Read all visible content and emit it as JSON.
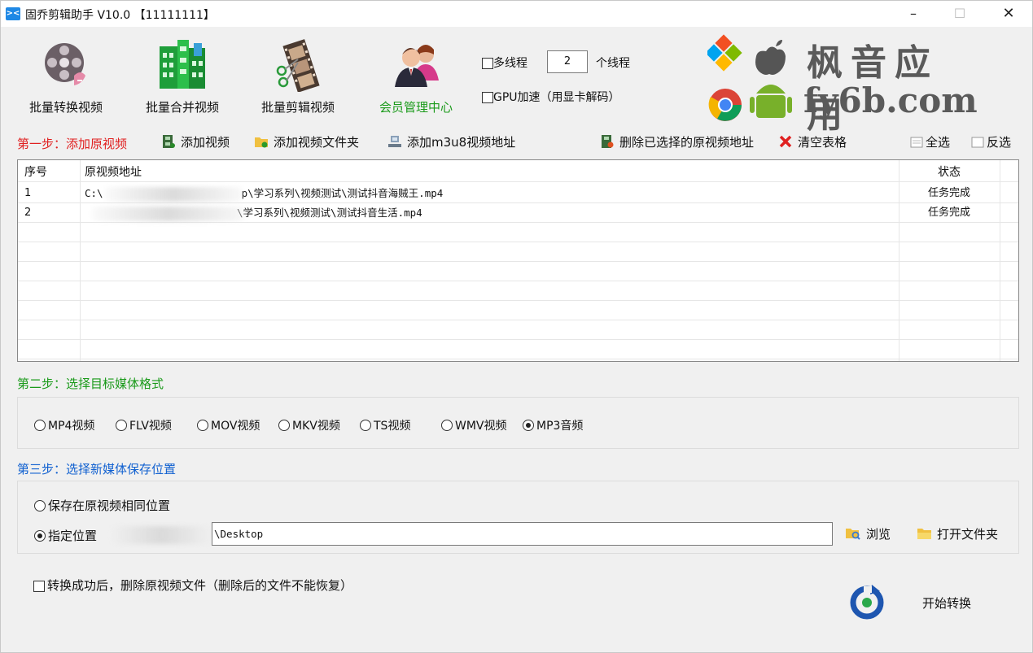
{
  "window": {
    "title": "固乔剪辑助手 V10.0 【11111111】",
    "minimize": "–",
    "maximize": "☐",
    "close": "✕"
  },
  "top_buttons": [
    {
      "label": "批量转换视频",
      "icon": "film-reel-icon"
    },
    {
      "label": "批量合并视频",
      "icon": "building-blocks-icon"
    },
    {
      "label": "批量剪辑视频",
      "icon": "film-strip-scissors-icon"
    },
    {
      "label": "会员管理中心",
      "icon": "users-icon"
    }
  ],
  "options": {
    "multithread_label": "多线程",
    "multithread_checked": false,
    "thread_count": "2",
    "thread_unit": "个线程",
    "gpu_label": "GPU加速（用显卡解码）",
    "gpu_checked": false
  },
  "watermark": {
    "line1": "枫音应用",
    "line2": "fy6b.com"
  },
  "step1": {
    "label": "第一步：添加原视频",
    "add_video": "添加视频",
    "add_folder": "添加视频文件夹",
    "add_m3u8": "添加m3u8视频地址",
    "delete_selected": "删除已选择的原视频地址",
    "clear_table": "清空表格",
    "select_all": "全选",
    "invert_select": "反选"
  },
  "table": {
    "headers": [
      "序号",
      "原视频地址",
      "状态"
    ],
    "rows": [
      {
        "index": "1",
        "path_prefix": "C:\\",
        "path_suffix": "p\\学习系列\\视频测试\\测试抖音海贼王.mp4",
        "status": "任务完成"
      },
      {
        "index": "2",
        "path_prefix": "",
        "path_suffix": "\\学习系列\\视频测试\\测试抖音生活.mp4",
        "status": "任务完成"
      }
    ]
  },
  "step2": {
    "label": "第二步：选择目标媒体格式",
    "formats": [
      "MP4视频",
      "FLV视频",
      "MOV视频",
      "MKV视频",
      "TS视频",
      "WMV视频",
      "MP3音频"
    ],
    "selected": "MP3音频"
  },
  "step3": {
    "label": "第三步：选择新媒体保存位置",
    "same_location": "保存在原视频相同位置",
    "custom_location": "指定位置",
    "custom_selected": true,
    "path_value": "\\Desktop",
    "browse": "浏览",
    "open_folder": "打开文件夹"
  },
  "footer": {
    "delete_after_label": "转换成功后，删除原视频文件（删除后的文件不能恢复）",
    "delete_after_checked": false,
    "start_label": "开始转换"
  },
  "colors": {
    "step1": "#e02020",
    "step2": "#1a9a1a",
    "step3": "#1060d0",
    "member": "#1a9a1a"
  }
}
